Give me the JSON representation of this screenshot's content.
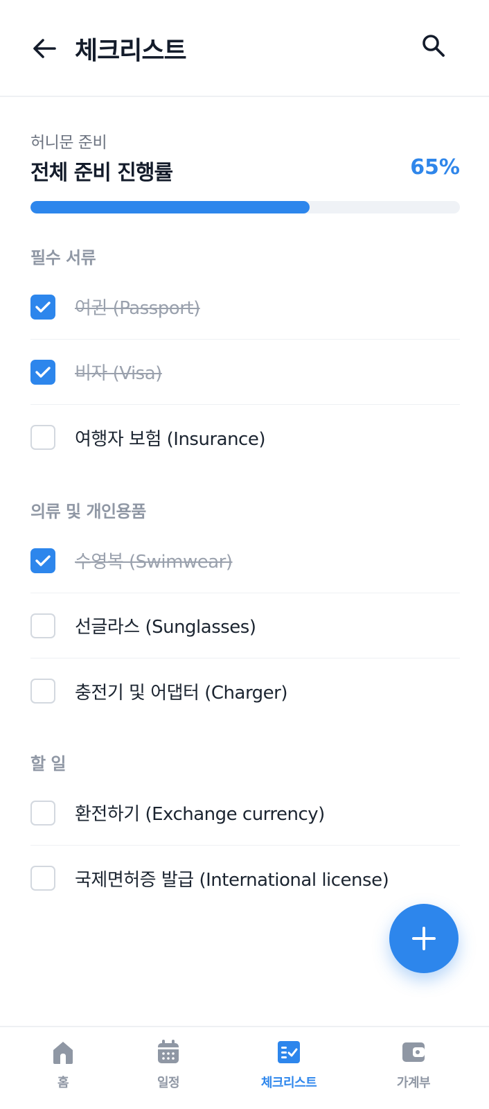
{
  "header": {
    "title": "체크리스트"
  },
  "progress": {
    "subtitle": "허니문 준비",
    "title": "전체 준비 진행률",
    "percent_label": "65%",
    "percent": 65
  },
  "sections": [
    {
      "label": "필수 서류",
      "items": [
        {
          "label": "여권 (Passport)",
          "checked": true
        },
        {
          "label": "비자 (Visa)",
          "checked": true
        },
        {
          "label": "여행자 보험 (Insurance)",
          "checked": false
        }
      ]
    },
    {
      "label": "의류 및 개인용품",
      "items": [
        {
          "label": "수영복 (Swimwear)",
          "checked": true
        },
        {
          "label": "선글라스 (Sunglasses)",
          "checked": false
        },
        {
          "label": "충전기 및 어댑터 (Charger)",
          "checked": false
        }
      ]
    },
    {
      "label": "할 일",
      "items": [
        {
          "label": "환전하기 (Exchange currency)",
          "checked": false
        },
        {
          "label": "국제면허증 발급 (International license)",
          "checked": false
        }
      ]
    }
  ],
  "nav": {
    "items": [
      {
        "label": "홈",
        "icon": "home-icon",
        "active": false
      },
      {
        "label": "일정",
        "icon": "calendar-icon",
        "active": false
      },
      {
        "label": "체크리스트",
        "icon": "checklist-icon",
        "active": true
      },
      {
        "label": "가계부",
        "icon": "wallet-icon",
        "active": false
      }
    ]
  },
  "colors": {
    "accent": "#2d86ec",
    "text": "#141c2b",
    "muted": "#8f97a4"
  }
}
